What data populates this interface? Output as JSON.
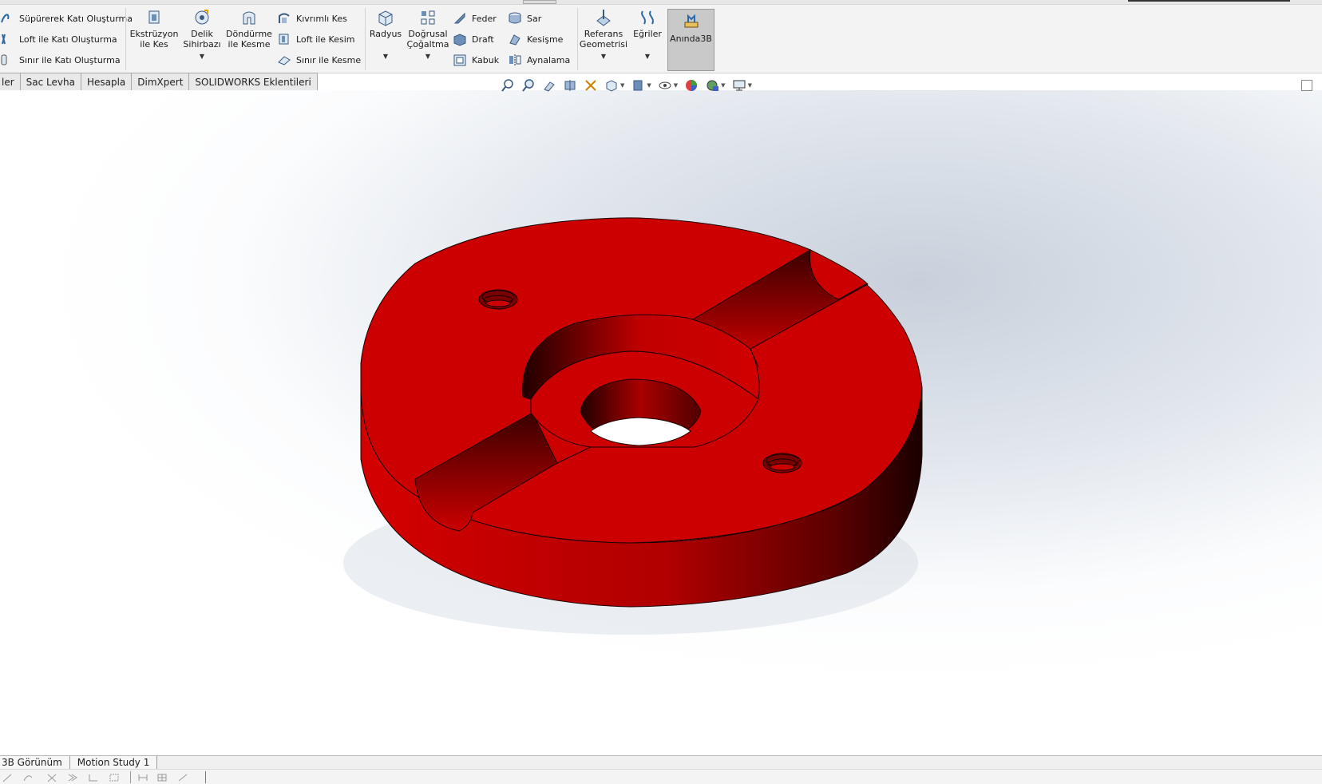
{
  "ribbon": {
    "sweep_boss": "Süpürerek Katı Oluşturma",
    "loft_boss": "Loft ile Katı Oluşturma",
    "boundary_boss": "Sınır ile Katı Oluşturma",
    "extruded_cut": "Ekstrüzyon\nile Kes",
    "extruded_cut_l1": "Ekstrüzyon",
    "extruded_cut_l2": "ile Kes",
    "hole_wizard_l1": "Delik",
    "hole_wizard_l2": "Sihirbazı",
    "revolved_cut_l1": "Döndürme",
    "revolved_cut_l2": "ile Kesme",
    "swept_cut": "Kıvrımlı Kes",
    "lofted_cut": "Loft ile Kesim",
    "boundary_cut": "Sınır ile Kesme",
    "fillet": "Radyus",
    "linear_pattern_l1": "Doğrusal",
    "linear_pattern_l2": "Çoğaltma",
    "rib": "Feder",
    "draft": "Draft",
    "shell": "Kabuk",
    "wrap": "Sar",
    "intersect": "Kesişme",
    "mirror": "Aynalama",
    "ref_geom_l1": "Referans",
    "ref_geom_l2": "Geometrisi",
    "curves": "Eğriler",
    "instant3d": "Anında3B"
  },
  "tabs": [
    "ler",
    "Sac Levha",
    "Hesapla",
    "DimXpert",
    "SOLIDWORKS Eklentileri"
  ],
  "bottom_tabs": [
    "3B Görünüm",
    "Motion Study 1"
  ],
  "model": {
    "color": "#cc0000",
    "edge_color": "#1a0000"
  }
}
